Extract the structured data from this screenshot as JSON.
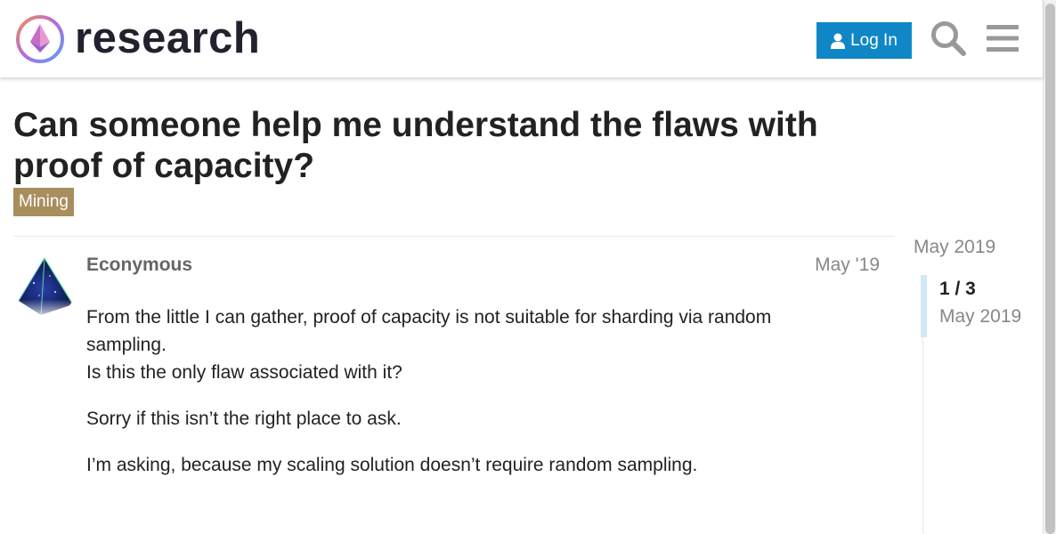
{
  "header": {
    "site_name": "research",
    "login_label": "Log In",
    "brand_color": "#0f87c6",
    "icons": [
      "logo-icon",
      "user-icon",
      "search-icon",
      "hamburger-menu-icon"
    ]
  },
  "topic": {
    "title": "Can someone help me understand the flaws with proof of capacity?",
    "category": "Mining",
    "category_color": "#a88e5d"
  },
  "post": {
    "username": "Econymous",
    "date": "May '19",
    "paragraphs": [
      "From the little I can gather, proof of capacity is not suitable for sharding via random sampling.",
      "Is this the only flaw associated with it?",
      "Sorry if this isn’t the right place to ask.",
      "I’m asking, because my scaling solution doesn’t require random sampling."
    ]
  },
  "timeline": {
    "start_date": "May 2019",
    "position": "1 / 3",
    "current_date": "May 2019"
  }
}
